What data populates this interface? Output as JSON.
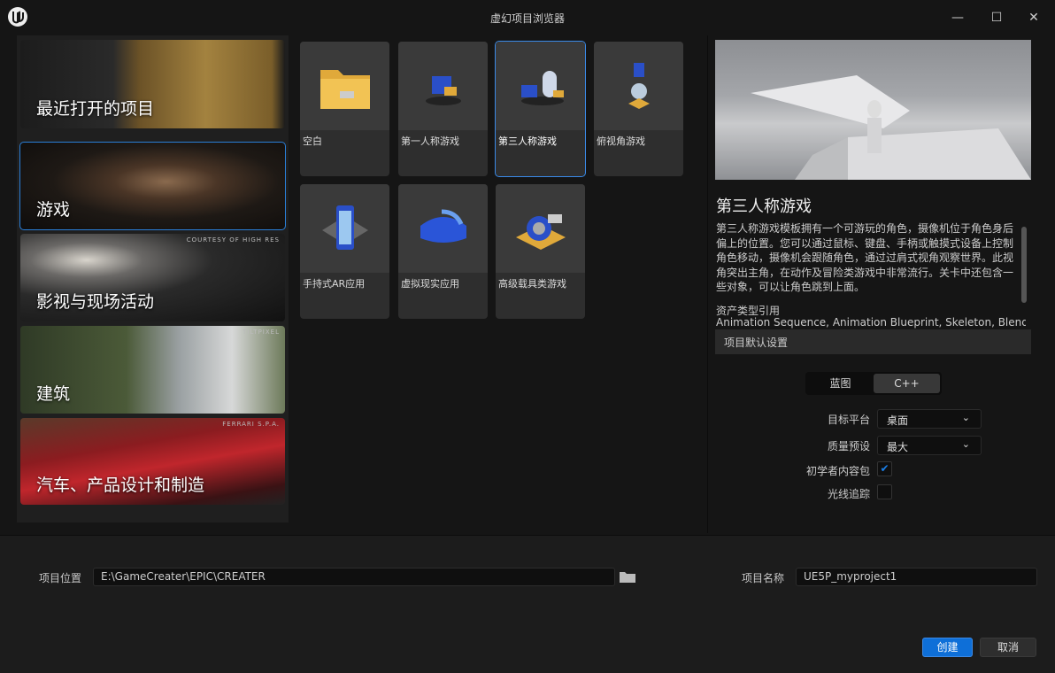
{
  "window": {
    "title": "虚幻项目浏览器",
    "minimize": "—",
    "maximize": "☐",
    "close": "✕"
  },
  "categories": [
    {
      "label": "最近打开的项目",
      "credit": ""
    },
    {
      "label": "游戏",
      "credit": ""
    },
    {
      "label": "影视与现场活动",
      "credit": "COURTESY OF HIGH RES"
    },
    {
      "label": "建筑",
      "credit": "TILTPIXEL"
    },
    {
      "label": "汽车、产品设计和制造",
      "credit": "FERRARI S.P.A."
    }
  ],
  "templates": [
    {
      "label": "空白",
      "icon": "folder-icon"
    },
    {
      "label": "第一人称游戏",
      "icon": "first-person-icon"
    },
    {
      "label": "第三人称游戏",
      "icon": "third-person-icon",
      "selected": true
    },
    {
      "label": "俯视角游戏",
      "icon": "top-down-icon"
    },
    {
      "label": "手持式AR应用",
      "icon": "ar-phone-icon"
    },
    {
      "label": "虚拟现实应用",
      "icon": "vr-headset-icon"
    },
    {
      "label": "高级载具类游戏",
      "icon": "vehicle-icon"
    }
  ],
  "details": {
    "title": "第三人称游戏",
    "description": "第三人称游戏模板拥有一个可游玩的角色，摄像机位于角色身后偏上的位置。您可以通过鼠标、键盘、手柄或触摸式设备上控制角色移动，摄像机会跟随角色，通过过肩式视角观察世界。此视角突出主角，在动作及冒险类游戏中非常流行。关卡中还包含一些对象，可以让角色跳到上面。",
    "assets_label": "资产类型引用",
    "assets": "Animation Sequence, Animation Blueprint, Skeleton, Blend",
    "defaults_header": "项目默认设置"
  },
  "settings": {
    "blueprint": "蓝图",
    "cpp": "C++",
    "selected_mode": "C++",
    "platform_label": "目标平台",
    "platform_value": "桌面",
    "quality_label": "质量预设",
    "quality_value": "最大",
    "starter_label": "初学者内容包",
    "starter_checked": true,
    "raytrace_label": "光线追踪",
    "raytrace_checked": false,
    "check_glyph": "✔",
    "chevron": "⌄"
  },
  "footer": {
    "location_label": "项目位置",
    "location_value": "E:\\GameCreater\\EPIC\\CREATER",
    "name_label": "项目名称",
    "name_value": "UE5P_myproject1",
    "create": "创建",
    "cancel": "取消"
  },
  "colors": {
    "accent": "#0e6fd8",
    "background": "#151515"
  }
}
